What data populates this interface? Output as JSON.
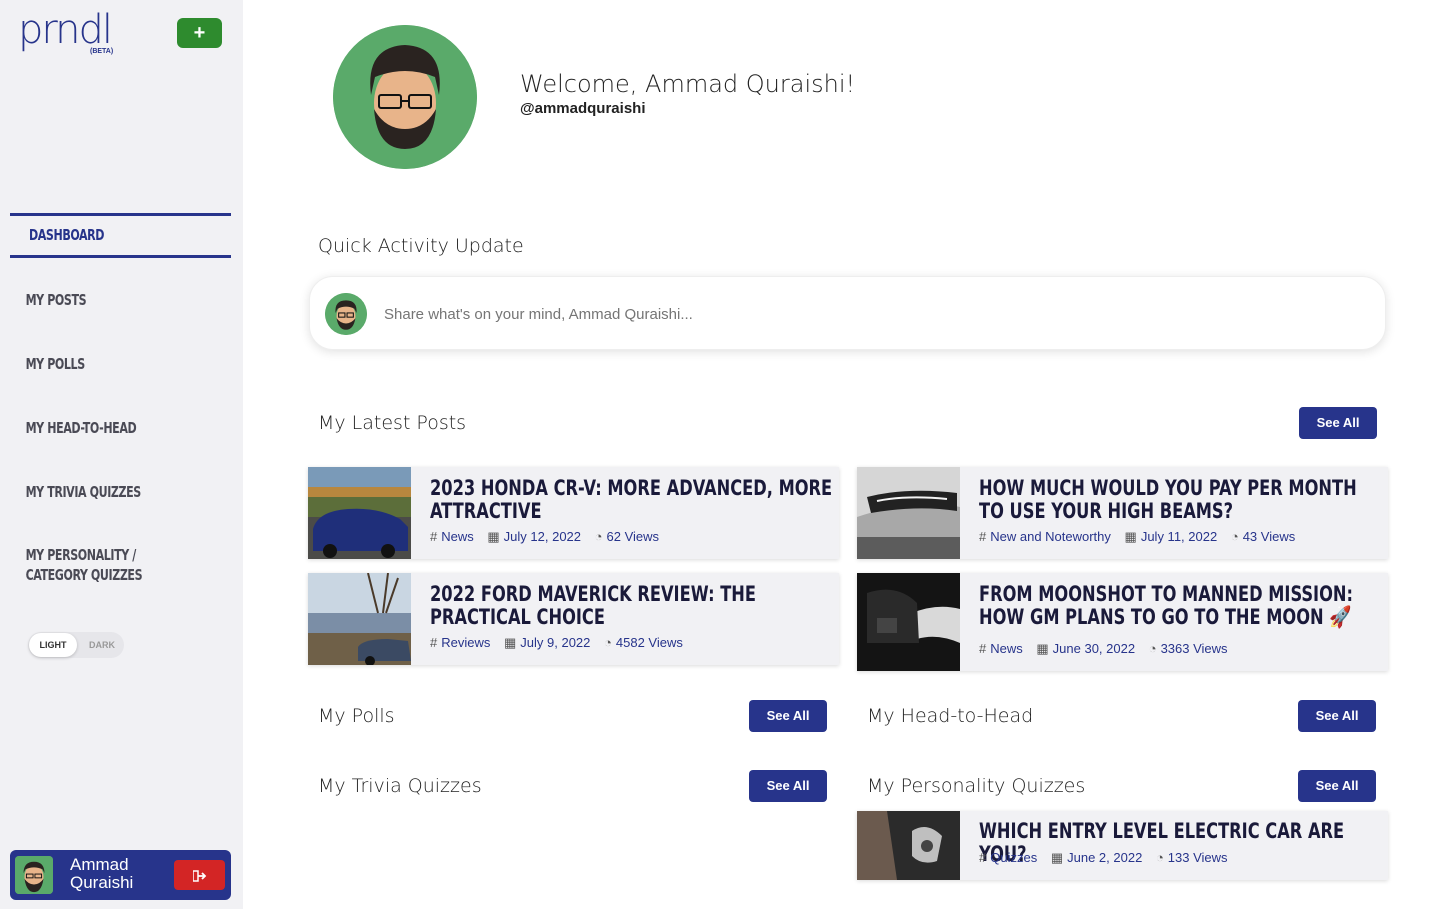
{
  "brand": {
    "logo": "prndl",
    "beta": "(BETA)",
    "add_label": "+"
  },
  "nav": {
    "items": [
      {
        "label": "Dashboard"
      },
      {
        "label": "My Posts"
      },
      {
        "label": "My Polls"
      },
      {
        "label": "My Head-to-Head"
      },
      {
        "label": "My Trivia Quizzes"
      },
      {
        "label": "My Personality / Category Quizzes"
      }
    ]
  },
  "theme": {
    "light": "LIGHT",
    "dark": "DARK"
  },
  "user": {
    "first": "Ammad",
    "last": "Quraishi",
    "logout_icon": "logout-icon"
  },
  "profile": {
    "welcome": "Welcome, Ammad Quraishi!",
    "handle": "@ammadquraishi"
  },
  "quick_activity": {
    "title": "Quick Activity Update",
    "placeholder": "Share what's on your mind, Ammad Quraishi..."
  },
  "latest_posts": {
    "title": "My Latest Posts",
    "see_all": "See All",
    "posts": [
      {
        "title": "2023 Honda CR-V: More Advanced, More Attractive",
        "category": "News",
        "date": "July 12, 2022",
        "views": "62 Views"
      },
      {
        "title": "How much would you pay per month to use your high beams?",
        "category": "New and Noteworthy",
        "date": "July 11, 2022",
        "views": "43 Views"
      },
      {
        "title": "2022 Ford Maverick Review: The Practical Choice",
        "category": "Reviews",
        "date": "July 9, 2022",
        "views": "4582 Views"
      },
      {
        "title": "From Moonshot to Manned Mission: How GM Plans to Go to the Moon 🚀",
        "category": "News",
        "date": "June 30, 2022",
        "views": "3363 Views"
      }
    ]
  },
  "polls": {
    "title": "My Polls",
    "see_all": "See All"
  },
  "head_to_head": {
    "title": "My Head-to-Head",
    "see_all": "See All"
  },
  "trivia": {
    "title": "My Trivia Quizzes",
    "see_all": "See All"
  },
  "personality": {
    "title": "My Personality Quizzes",
    "see_all": "See All",
    "posts": [
      {
        "title": "Which Entry Level Electric Car Are You?",
        "category": "Quizzes",
        "date": "June 2, 2022",
        "views": "133 Views"
      }
    ]
  },
  "colors": {
    "accent": "#27348b",
    "add": "#2e8b2e",
    "logout": "#d32525",
    "avatar_bg": "#5aaa6a"
  }
}
